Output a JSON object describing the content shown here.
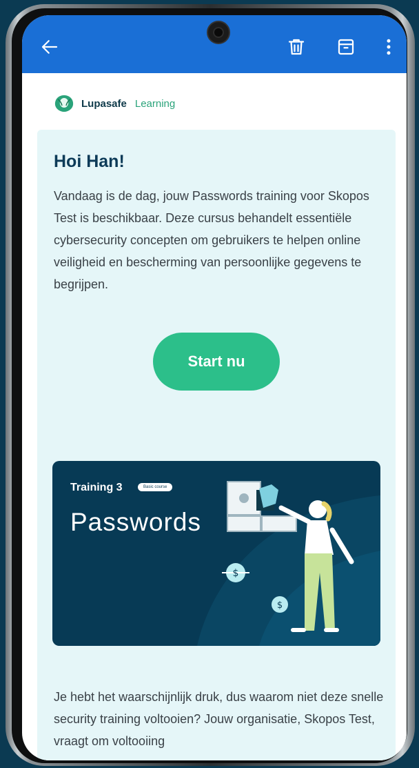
{
  "appbar": {
    "icons": [
      "arrow-back-icon",
      "trash-icon",
      "archive-icon",
      "more-vert-icon"
    ],
    "color": "#1a6fd6"
  },
  "brand": {
    "name": "Lupasafe",
    "sub": "Learning"
  },
  "email": {
    "greeting": "Hoi Han!",
    "intro": "Vandaag is de dag, jouw Passwords training voor Skopos Test is beschikbaar. Deze cursus behandelt essentiële cybersecurity concepten om gebruikers te helpen online veiligheid en bescherming van persoonlijke gegevens te begrijpen.",
    "cta_label": "Start nu",
    "outro": "Je hebt het waarschijnlijk druk, dus waarom niet deze snelle security training voltooien? Jouw organisatie, Skopos Test, vraagt om voltooiing"
  },
  "banner": {
    "title": "Training 3",
    "badge": "Basic course",
    "course": "Passwords",
    "bg_color": "#073a55"
  },
  "colors": {
    "accent": "#2cbf8a",
    "card_bg": "#e5f6f8",
    "heading": "#0d3b58"
  }
}
